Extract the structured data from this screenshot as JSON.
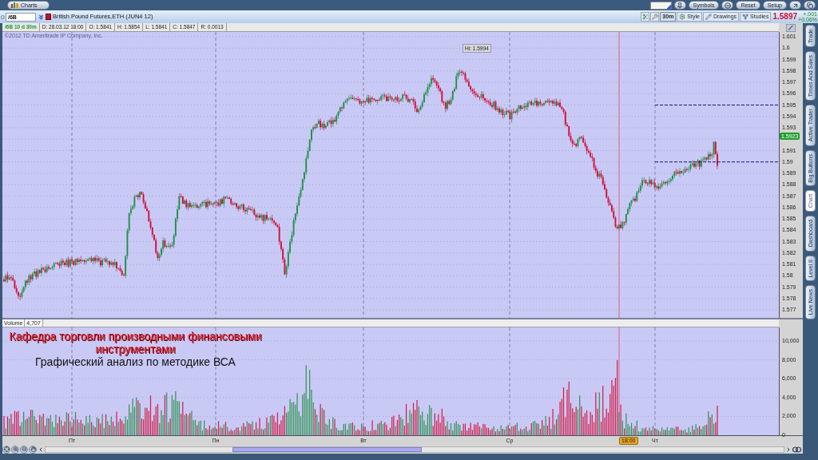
{
  "title_bar": {
    "tab": "Charts",
    "buttons": [
      "Symbols",
      "Reset",
      "Setup"
    ]
  },
  "toolbar": {
    "symbol": "/6B",
    "description": "British Pound Futures,ETH (JUN4 12)",
    "aggregation": "30m",
    "buttons": [
      "Style",
      "Drawings",
      "Studies"
    ],
    "last_price": "1.5897",
    "change": "+.001",
    "change_percent": "+0.06%"
  },
  "info_bar": {
    "study": "/6B 10 d 30m",
    "fields": [
      "D: 28.03.12 18:00",
      "O: 1.5841",
      "H: 1.5854",
      "L: 1.5841",
      "C: 1.5847",
      "R: 0.0013"
    ]
  },
  "price_chart": {
    "copyright": "©2012 TD Ameritrade IP Company, Inc.",
    "high_label": "Hi: 1.5994",
    "axis": [
      {
        "kind": "tick",
        "label": "1.601"
      },
      {
        "kind": "tick",
        "label": "1.6"
      },
      {
        "kind": "tick",
        "label": "1.599"
      },
      {
        "kind": "tick",
        "label": "1.598"
      },
      {
        "kind": "tick",
        "label": "1.597"
      },
      {
        "kind": "tick",
        "label": "1.596"
      },
      {
        "kind": "tick",
        "label": "1.595"
      },
      {
        "kind": "tick",
        "label": "1.594"
      },
      {
        "kind": "tick",
        "label": "1.593"
      },
      {
        "kind": "current",
        "label": "1.5923"
      },
      {
        "kind": "tick",
        "label": "1.591"
      },
      {
        "kind": "tick",
        "label": "1.59"
      },
      {
        "kind": "tick",
        "label": "1.589"
      },
      {
        "kind": "tick",
        "label": "1.588"
      },
      {
        "kind": "tick",
        "label": "1.587"
      },
      {
        "kind": "tick",
        "label": "1.586"
      },
      {
        "kind": "tick",
        "label": "1.585"
      },
      {
        "kind": "tick",
        "label": "1.584"
      },
      {
        "kind": "tick",
        "label": "1.583"
      },
      {
        "kind": "tick",
        "label": "1.582"
      },
      {
        "kind": "tick",
        "label": "1.581"
      },
      {
        "kind": "tick",
        "label": "1.58"
      },
      {
        "kind": "tick",
        "label": "1.579"
      },
      {
        "kind": "tick",
        "label": "1.578"
      },
      {
        "kind": "tick",
        "label": "1.577"
      }
    ]
  },
  "volume_chart": {
    "label": "Volume",
    "value": "4,707",
    "axis": [
      "10,000",
      "8,000",
      "6,000",
      "4,000",
      "2,000",
      "0"
    ]
  },
  "overlay": {
    "title": "Кафедра торговли производными финансовыми инструментами",
    "subtitle": "Графический анализ по методике ВСА"
  },
  "x_axis": {
    "labels": [
      "Пт",
      "Пн",
      "Вт",
      "Ср",
      "Чт"
    ],
    "cursor": "18:00"
  },
  "side_tabs": [
    {
      "label": "Trade",
      "selected": false
    },
    {
      "label": "Times And Sales",
      "selected": false
    },
    {
      "label": "Active Trader",
      "selected": false
    },
    {
      "label": "Big Buttons",
      "selected": false
    },
    {
      "label": "Chart",
      "selected": true
    },
    {
      "label": "Dashboard",
      "selected": false
    },
    {
      "label": "Level II",
      "selected": false
    },
    {
      "label": "Live News",
      "selected": false
    }
  ]
}
